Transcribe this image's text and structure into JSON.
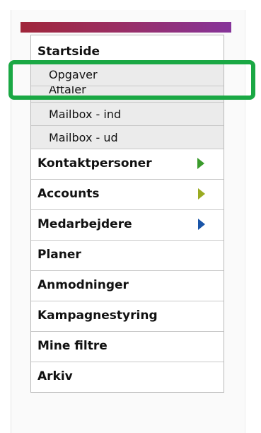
{
  "colors": {
    "accent_bar_start": "#a0263a",
    "accent_bar_end": "#86349a",
    "highlight": "#1aa844",
    "arrow_green": "#3a9b2c",
    "arrow_olive": "#9aab22",
    "arrow_blue": "#1a55a8"
  },
  "menu": {
    "home": "Startside",
    "sub_items": [
      {
        "label": "Opgaver"
      },
      {
        "label": "Aftaler"
      },
      {
        "label": "Mailbox - ind"
      },
      {
        "label": "Mailbox - ud"
      }
    ],
    "main_items": [
      {
        "label": "Kontaktpersoner",
        "arrow": "green"
      },
      {
        "label": "Accounts",
        "arrow": "olive"
      },
      {
        "label": "Medarbejdere",
        "arrow": "blue"
      },
      {
        "label": "Planer"
      },
      {
        "label": "Anmodninger"
      },
      {
        "label": "Kampagnestyring"
      },
      {
        "label": "Mine filtre"
      },
      {
        "label": "Arkiv"
      }
    ]
  }
}
